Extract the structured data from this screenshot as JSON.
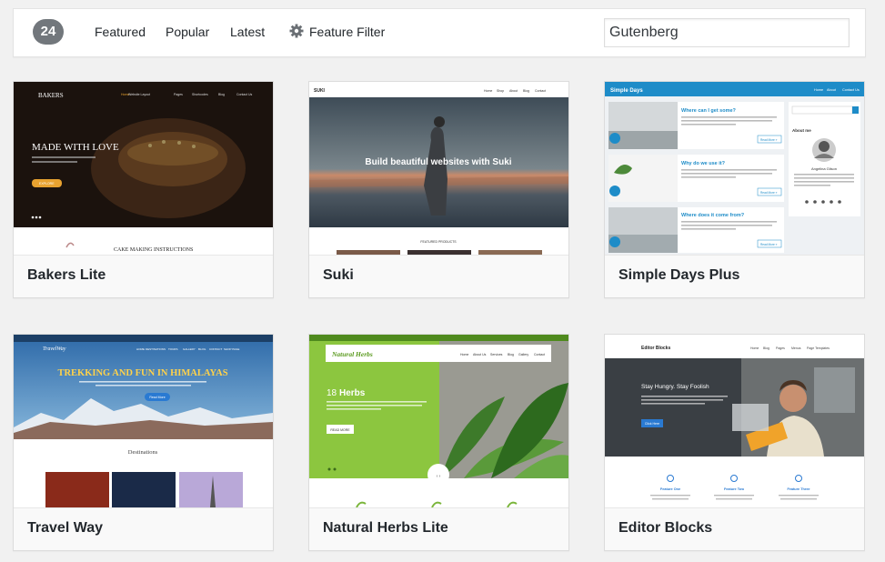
{
  "filter_bar": {
    "count": "24",
    "links": [
      "Featured",
      "Popular",
      "Latest"
    ],
    "feature_filter": "Feature Filter",
    "gear_icon": "gear-icon",
    "search_value": "Gutenberg"
  },
  "themes": [
    {
      "name": "Bakers Lite",
      "preview": {
        "brand": "BAKERS",
        "menu": [
          "Home",
          "Website Layout",
          "Pages",
          "Shortcodes",
          "Blog",
          "Contact Us"
        ],
        "headline": "MADE WITH LOVE",
        "button": "EXPLORE",
        "section_title": "CAKE MAKING INSTRUCTIONS"
      }
    },
    {
      "name": "Suki",
      "preview": {
        "brand": "SUKI",
        "menu": [
          "Home",
          "Shop",
          "About",
          "Blog",
          "Contact"
        ],
        "headline": "Build beautiful websites with Suki",
        "section_title": "FEATURED PRODUCTS"
      }
    },
    {
      "name": "Simple Days Plus",
      "preview": {
        "brand": "Simple Days",
        "menu": [
          "Home",
          "About",
          "Contact Us"
        ],
        "posts": [
          "Where can I get some?",
          "Why do we use it?",
          "Where does it come from?"
        ],
        "read_more": "Read More »",
        "sidebar_title": "About me",
        "author": "Angelina Gilson"
      }
    },
    {
      "name": "Travel Way",
      "preview": {
        "brand": "TravelWay",
        "menu": [
          "HOME",
          "DESTINATIONS",
          "TOURS",
          "GALLERY",
          "BLOG",
          "CONTACT",
          "SHOP PAGE"
        ],
        "headline": "TREKKING AND FUN IN HIMALAYAS",
        "button": "Read More",
        "section_title": "Destinations"
      }
    },
    {
      "name": "Natural Herbs Lite",
      "preview": {
        "brand": "Natural Herbs",
        "menu": [
          "Home",
          "About Us",
          "Services",
          "Blog",
          "Gallery",
          "Contact"
        ],
        "headline_number": "18",
        "headline_word": "Herbs",
        "button": "READ MORE"
      }
    },
    {
      "name": "Editor Blocks",
      "preview": {
        "brand": "Editor Blocks",
        "menu": [
          "Home",
          "Blog",
          "Pages",
          "Menus",
          "Page Templates"
        ],
        "headline": "Stay Hungry. Stay Foolish",
        "button": "Click Here",
        "features": [
          "Feature One",
          "Feature Two",
          "Feature Three"
        ]
      }
    }
  ]
}
